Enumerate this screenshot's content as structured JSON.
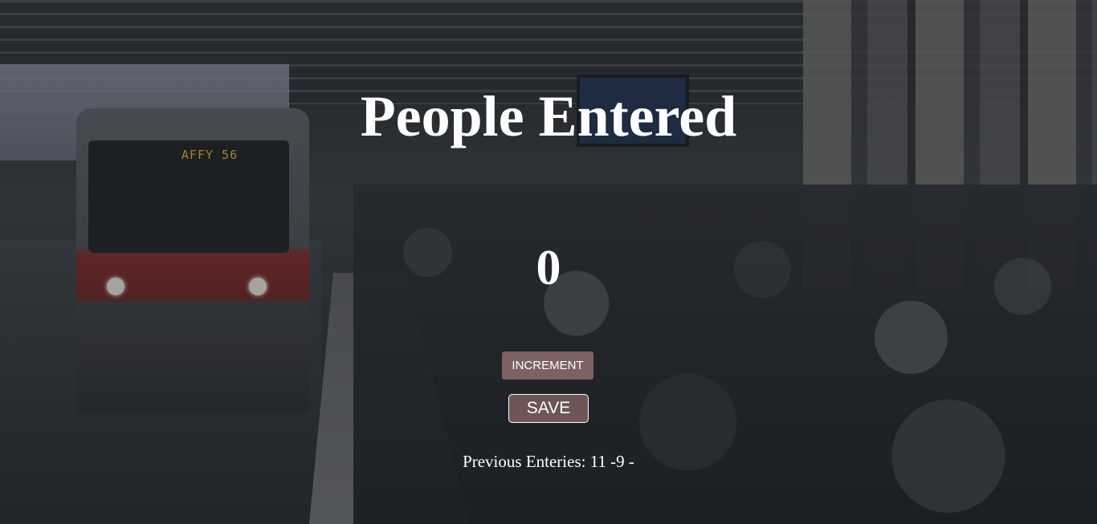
{
  "page": {
    "title": "People Entered",
    "count": "0"
  },
  "buttons": {
    "increment_label": "INCREMENT",
    "save_label": "SAVE"
  },
  "previous_entries": {
    "label": "Previous Enteries:",
    "values": "11 -9 -"
  },
  "colors": {
    "increment_button": "#7d6262",
    "save_button": "#6e5656",
    "text": "#ffffff"
  },
  "background": {
    "train_sign": "AFFY 56"
  }
}
